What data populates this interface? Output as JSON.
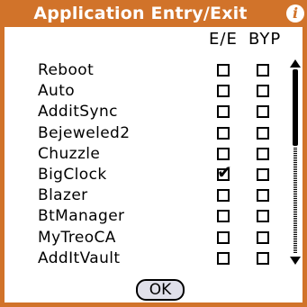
{
  "dialog": {
    "title": "Application Entry/Exit",
    "info_icon": "info-icon",
    "accent_color": "#d1732a"
  },
  "columns": {
    "ee": "E/E",
    "byp": "BYP"
  },
  "apps": [
    {
      "name": "Reboot",
      "ee": false,
      "byp": false
    },
    {
      "name": "Auto",
      "ee": false,
      "byp": false
    },
    {
      "name": "AdditSync",
      "ee": false,
      "byp": false
    },
    {
      "name": "Bejeweled2",
      "ee": false,
      "byp": false
    },
    {
      "name": "Chuzzle",
      "ee": false,
      "byp": false
    },
    {
      "name": "BigClock",
      "ee": true,
      "byp": false
    },
    {
      "name": "Blazer",
      "ee": false,
      "byp": false
    },
    {
      "name": "BtManager",
      "ee": false,
      "byp": false
    },
    {
      "name": "MyTreoCA",
      "ee": false,
      "byp": false
    },
    {
      "name": "AddItVault",
      "ee": false,
      "byp": false
    }
  ],
  "buttons": {
    "ok_label": "OK"
  }
}
